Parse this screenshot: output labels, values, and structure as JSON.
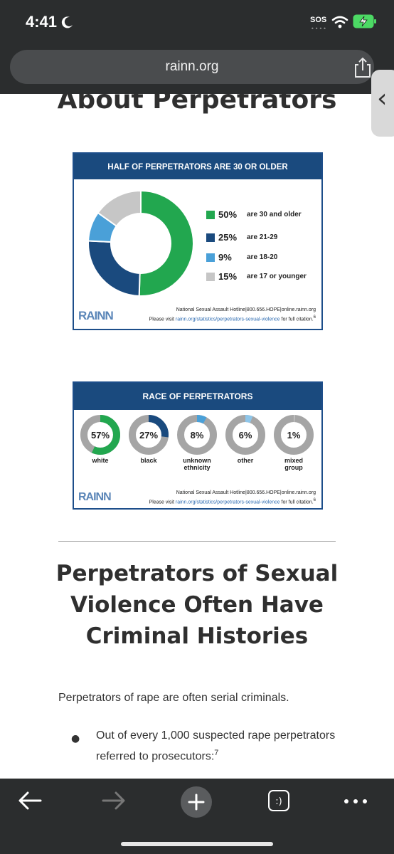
{
  "status": {
    "time": "4:41",
    "sos": "SOS"
  },
  "browser": {
    "url": "rainn.org"
  },
  "page": {
    "section_heading": "About Perpetrators",
    "age_infographic": {
      "title": "HALF OF PERPETRATORS ARE 30 OR OLDER",
      "legend": [
        {
          "pct": "50%",
          "label": "are 30 and older",
          "color": "#22a74f"
        },
        {
          "pct": "25%",
          "label": "are 21-29",
          "color": "#1a4a7e"
        },
        {
          "pct": "9%",
          "label": "are 18-20",
          "color": "#4aa0d8"
        },
        {
          "pct": "15%",
          "label": "are 17 or younger",
          "color": "#c6c6c6"
        }
      ],
      "logo": "RAINN",
      "footer_line1": "National Sexual Assault Hotline|800.656.HOPE|online.rainn.org",
      "footer_line2_prefix": "Please visit ",
      "footer_link": "rainn.org/statistics/perpetrators-sexual-violence",
      "footer_line2_suffix": " for full citation.",
      "footer_sup": "6"
    },
    "race_infographic": {
      "title": "RACE OF PERPETRATORS",
      "items": [
        {
          "pct": "57%",
          "label_1": "white",
          "label_2": "",
          "color": "#22a74f"
        },
        {
          "pct": "27%",
          "label_1": "black",
          "label_2": "",
          "color": "#1a4a7e"
        },
        {
          "pct": "8%",
          "label_1": "unknown",
          "label_2": "ethnicity",
          "color": "#4aa0d8"
        },
        {
          "pct": "6%",
          "label_1": "other",
          "label_2": "",
          "color": "#8ec6ea"
        },
        {
          "pct": "1%",
          "label_1": "mixed",
          "label_2": "group",
          "color": "#c6c6c6"
        }
      ],
      "logo": "RAINN",
      "footer_line1": "National Sexual Assault Hotline|800.656.HOPE|online.rainn.org",
      "footer_line2_prefix": "Please visit ",
      "footer_link": "rainn.org/statistics/perpetrators-sexual-violence",
      "footer_line2_suffix": " for full citation.",
      "footer_sup": "6"
    },
    "heading_2": "Perpetrators of Sexual Violence Often Have Criminal Histories",
    "paragraph": "Perpetrators of rape are often serial criminals.",
    "bullet_text": "Out of every 1,000 suspected rape perpetrators referred to prosecutors:",
    "bullet_sup": "7"
  },
  "chart_data": [
    {
      "type": "pie",
      "title": "HALF OF PERPETRATORS ARE 30 OR OLDER",
      "categories": [
        "are 30 and older",
        "are 21-29",
        "are 18-20",
        "are 17 or younger"
      ],
      "values": [
        50,
        25,
        9,
        15
      ]
    },
    {
      "type": "pie",
      "title": "RACE OF PERPETRATORS",
      "categories": [
        "white",
        "black",
        "unknown ethnicity",
        "other",
        "mixed group"
      ],
      "values": [
        57,
        27,
        8,
        6,
        1
      ]
    }
  ]
}
